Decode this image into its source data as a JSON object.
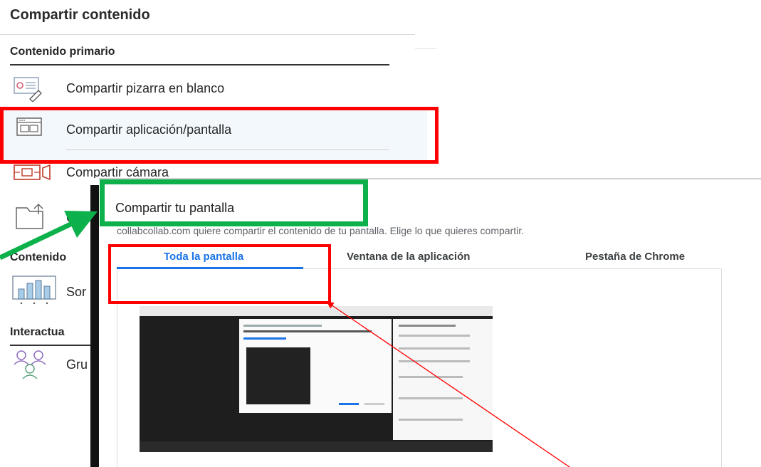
{
  "panel": {
    "title": "Compartir contenido",
    "section_primary": "Contenido primario",
    "items": [
      {
        "label": "Compartir pizarra en blanco",
        "icon": "whiteboard-icon"
      },
      {
        "label": "Compartir aplicación/pantalla",
        "icon": "app-screen-icon"
      },
      {
        "label": "Compartir cámara",
        "icon": "camera-icon"
      },
      {
        "label": "C",
        "icon": "folder-icon"
      }
    ],
    "section_secondary": "Contenido",
    "secondary_item": {
      "label": "Sor",
      "icon": "sound-icon"
    },
    "section_interact": "Interactua",
    "interact_item": {
      "label": "Gru",
      "icon": "groups-icon"
    }
  },
  "dialog": {
    "title": "Compartir tu pantalla",
    "subtitle": "collabcollab.com quiere compartir el contenido de tu pantalla. Elige lo que quieres compartir.",
    "tabs": [
      {
        "label": "Toda la pantalla",
        "selected": true
      },
      {
        "label": "Ventana de la aplicación",
        "selected": false
      },
      {
        "label": "Pestaña de Chrome",
        "selected": false
      }
    ]
  },
  "annotation_colors": {
    "red": "#ff0000",
    "green": "#0db14b",
    "accent": "#1a73e8"
  }
}
